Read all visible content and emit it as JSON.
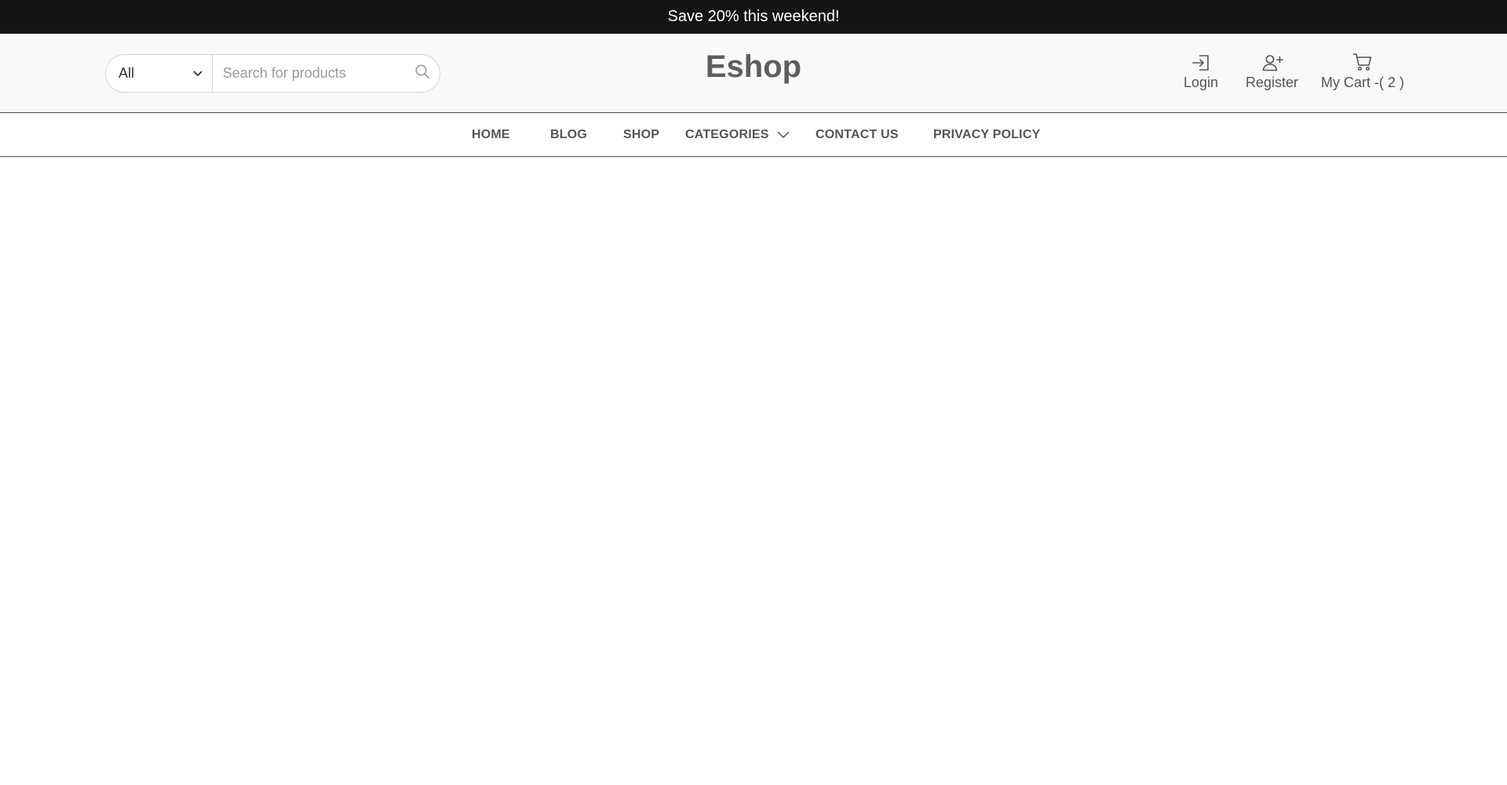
{
  "announcement": {
    "text": "Save 20% this weekend!"
  },
  "search": {
    "category_value": "All",
    "placeholder": "Search for products",
    "search_icon": "search-icon",
    "dropdown_icon": "chevron-down-icon"
  },
  "brand": {
    "logo": "Eshop"
  },
  "account": {
    "login": {
      "label": "Login",
      "icon": "login-icon"
    },
    "register": {
      "label": "Register",
      "icon": "add-user-icon"
    },
    "cart": {
      "label": "My Cart -( 2 )",
      "icon": "cart-icon"
    }
  },
  "nav": {
    "items": [
      {
        "label": "HOME"
      },
      {
        "label": "BLOG"
      },
      {
        "label": "SHOP"
      },
      {
        "label": "CATEGORIES",
        "icon": "chevron-down-icon"
      },
      {
        "label": "CONTACT US"
      },
      {
        "label": "PRIVACY POLICY"
      }
    ]
  },
  "colors": {
    "announcement_bg": "#141414",
    "header_bg": "#f9f9f9",
    "text": "#555555",
    "logo": "#5e5e5e"
  }
}
